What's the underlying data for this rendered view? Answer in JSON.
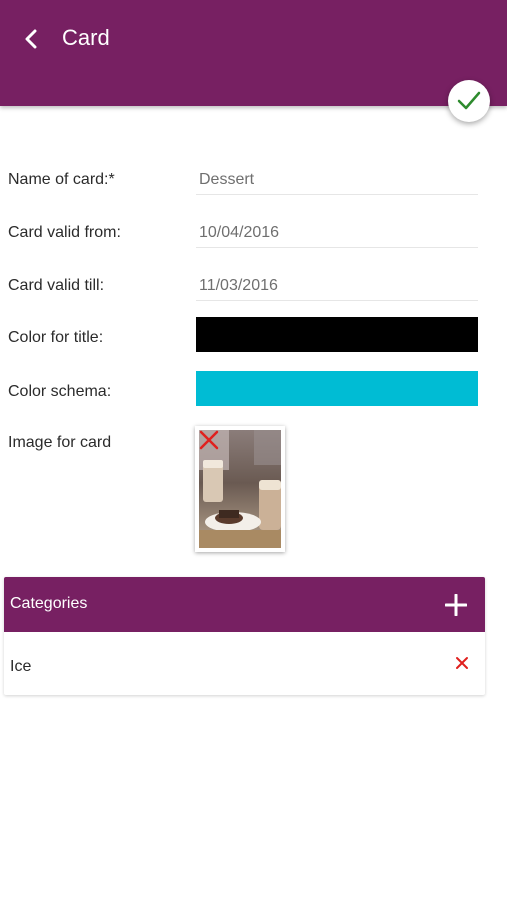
{
  "app_bar": {
    "title": "Card",
    "back_icon": "chevron-left-icon",
    "save_icon": "check-icon",
    "background_color": "#772062",
    "check_color": "#2e8b2e"
  },
  "form": {
    "name": {
      "label": "Name of card:*",
      "value": "Dessert"
    },
    "valid_from": {
      "label": "Card valid from:",
      "value": "10/04/2016"
    },
    "valid_till": {
      "label": "Card valid till:",
      "value": "11/03/2016"
    },
    "title_color": {
      "label": "Color for title:",
      "color": "#000000"
    },
    "color_schema": {
      "label": "Color schema:",
      "color": "#00bcd4"
    },
    "image": {
      "label": "Image for card",
      "remove_icon": "close-icon"
    }
  },
  "categories": {
    "title": "Categories",
    "add_icon": "plus-icon",
    "items": [
      {
        "label": "Ice",
        "remove_icon": "close-icon"
      }
    ]
  }
}
